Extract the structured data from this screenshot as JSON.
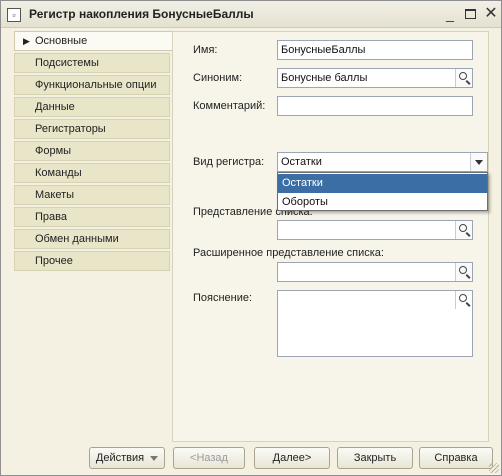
{
  "window": {
    "title": "Регистр накопления БонусныеБаллы",
    "app_icon": "1c-document-icon",
    "controls": [
      "minimize-icon",
      "maximize-icon",
      "close-icon"
    ]
  },
  "nav": {
    "items": [
      {
        "label": "Основные",
        "active": true
      },
      {
        "label": "Подсистемы"
      },
      {
        "label": "Функциональные опции"
      },
      {
        "label": "Данные"
      },
      {
        "label": "Регистраторы"
      },
      {
        "label": "Формы"
      },
      {
        "label": "Команды"
      },
      {
        "label": "Макеты"
      },
      {
        "label": "Права"
      },
      {
        "label": "Обмен данными"
      },
      {
        "label": "Прочее"
      }
    ]
  },
  "form": {
    "name_label": "Имя:",
    "name_value": "БонусныеБаллы",
    "synonym_label": "Синоним:",
    "synonym_value": "Бонусные баллы",
    "comment_label": "Комментарий:",
    "comment_value": "",
    "register_kind_label": "Вид регистра:",
    "register_kind_value": "Остатки",
    "register_kind_options": [
      "Остатки",
      "Обороты"
    ],
    "list_presentation_label": "Представление списка:",
    "list_presentation_value": "",
    "ext_list_presentation_label": "Расширенное представление списка:",
    "ext_list_presentation_value": "",
    "explanation_label": "Пояснение:",
    "explanation_value": ""
  },
  "footer": {
    "actions_label": "Действия",
    "back_label": "<Назад",
    "next_label": "Далее>",
    "close_label": "Закрыть",
    "help_label": "Справка"
  },
  "colors": {
    "window_bg": "#f4f1e2",
    "nav_item_bg": "#e9e5c9",
    "selected_option_bg": "#3a6ea5"
  }
}
